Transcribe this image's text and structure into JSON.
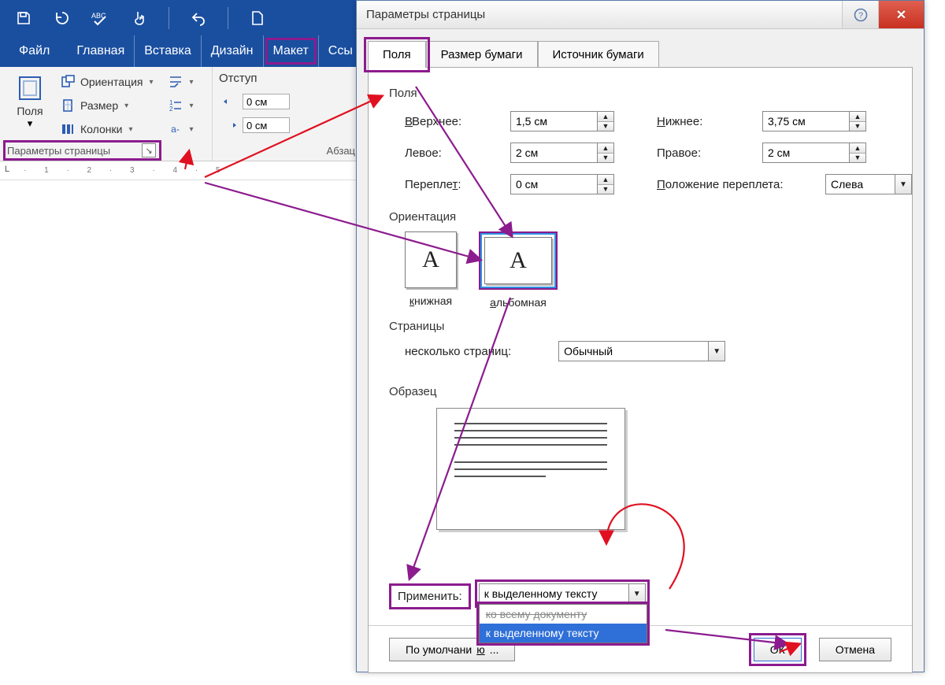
{
  "qat": {
    "tip_save": "save",
    "tip_refresh": "refresh",
    "tip_spell": "spell",
    "tip_touch": "touch",
    "tip_undo": "undo",
    "tip_new": "new"
  },
  "tabs": {
    "file": "Файл",
    "home": "Главная",
    "insert": "Вставка",
    "design": "Дизайн",
    "layout": "Макет",
    "refs": "Ссы"
  },
  "ribbon": {
    "margins_label": "Поля",
    "orientation": "Ориентация",
    "size": "Размер",
    "columns": "Колонки",
    "group_page_setup": "Параметры страницы",
    "indent_title": "Отступ",
    "indent_value": "0 см",
    "paragraph_group": "Абзац",
    "hyphen": "bć"
  },
  "ruler_marks": "· 1 · 2 · 3 · 4 · 5",
  "dialog": {
    "title": "Параметры страницы",
    "tabs": {
      "fields": "Поля",
      "paper": "Размер бумаги",
      "source": "Источник бумаги"
    },
    "section_fields": "Поля",
    "top": "Верхнее:",
    "top_u": "В",
    "bottom": "ижнее:",
    "bottom_u": "Н",
    "left": "Левое:",
    "right": "Правое:",
    "gutter": "Перепле",
    "gutter_u": "т",
    "gutter_suffix": ":",
    "gutter_pos": "оложение переплета:",
    "gutter_pos_u": "П",
    "val_top": "1,5 см",
    "val_bottom": "3,75 см",
    "val_left": "2 см",
    "val_right": "2 см",
    "val_gutter": "0 см",
    "val_gutter_pos": "Слева",
    "section_orient": "Ориентация",
    "portrait": "нижная",
    "portrait_u": "к",
    "landscape": "льбомная",
    "landscape_u": "а",
    "section_pages": "Страницы",
    "multi_pages": "есколько страниц:",
    "multi_pages_u": "н",
    "multi_val": "Обычный",
    "section_preview": "Образец",
    "apply": "Применит",
    "apply_u": "ь",
    "apply_suffix": ":",
    "apply_val": "к выделенному тексту",
    "apply_options": {
      "doc": "ко всему документу",
      "sel": "к выделенному тексту"
    },
    "defaults": "По умолчани",
    "defaults_u": "ю",
    "defaults_suffix": "...",
    "ok": "ОК",
    "cancel": "Отмена"
  }
}
